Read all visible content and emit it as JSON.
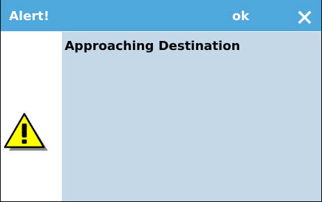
{
  "titlebar": {
    "title": "Alert!",
    "ok_label": "ok",
    "close_icon": "close-icon"
  },
  "dialog": {
    "icon": "warning-icon",
    "message": "Approaching Destination"
  },
  "colors": {
    "titlebar_bg": "#4fa7dc",
    "titlebar_text": "#ffffff",
    "message_panel_bg": "#c5d8e9",
    "warning_fill": "#ffff00"
  }
}
